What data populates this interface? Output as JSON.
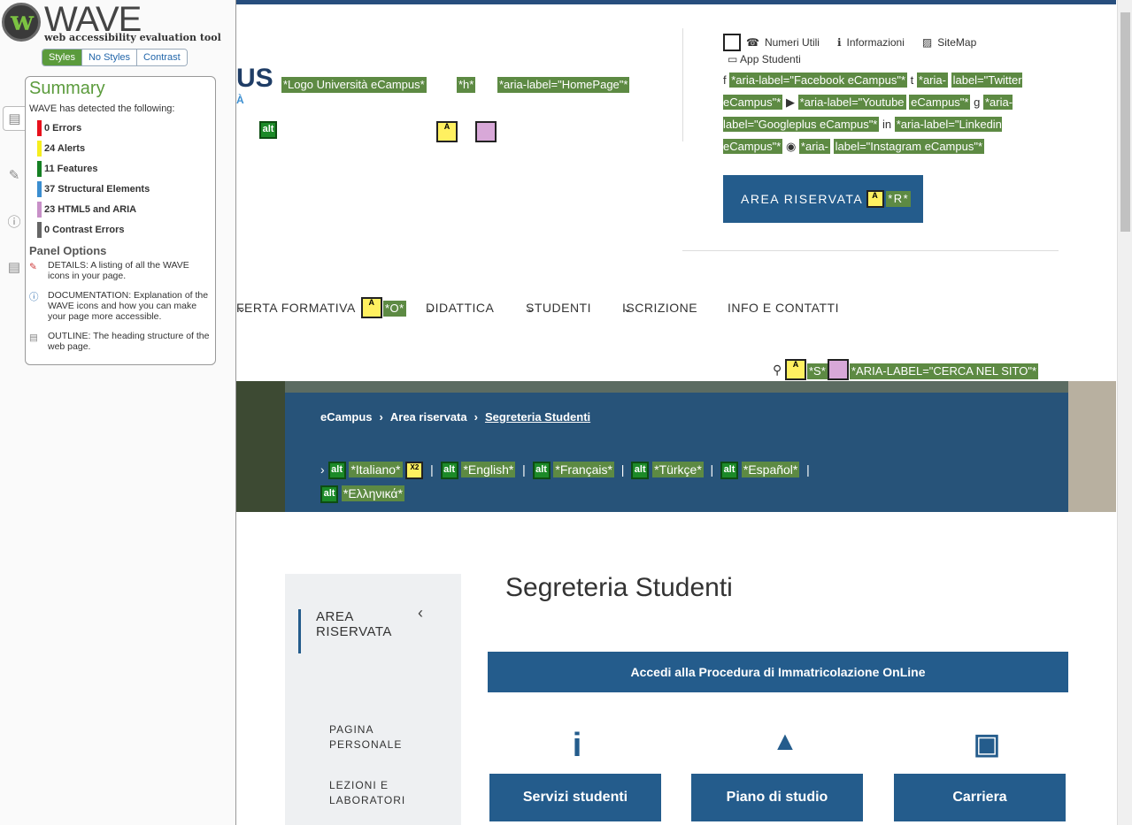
{
  "wave": {
    "title": "WAVE",
    "subtitle": "web accessibility evaluation tool",
    "tabs": [
      "Styles",
      "No Styles",
      "Contrast"
    ],
    "summary_title": "Summary",
    "intro": "WAVE has detected the following:",
    "stats": [
      {
        "label": "0 Errors",
        "color": "#e8101c"
      },
      {
        "label": "24 Alerts",
        "color": "#f6ee1e"
      },
      {
        "label": "11 Features",
        "color": "#158023"
      },
      {
        "label": "37 Structural Elements",
        "color": "#3b8ed0"
      },
      {
        "label": "23 HTML5 and ARIA",
        "color": "#c890c8"
      },
      {
        "label": "0 Contrast Errors",
        "color": "#666666"
      }
    ],
    "panel_options": "Panel Options",
    "options": [
      {
        "icon": "details-icon",
        "text": "DETAILS: A listing of all the WAVE icons in your page."
      },
      {
        "icon": "documentation-icon",
        "text": "DOCUMENTATION: Explanation of the WAVE icons and how you can make your page more accessible."
      },
      {
        "icon": "outline-icon",
        "text": "OUTLINE: The heading structure of the web page."
      }
    ]
  },
  "site": {
    "logo_fragment": "US",
    "logo_fragment_sub": "À",
    "labels": {
      "logo": "*Logo Università eCampus*",
      "h": "*h*",
      "homepage": "*aria-label=\"HomePage\"*",
      "o": "*O*",
      "s": "*S*",
      "cerca": "*ARIA-LABEL=\"CERCA NEL SITO\"*",
      "r": "*R*"
    },
    "util": {
      "numeri": "Numeri Utili",
      "informazioni": "Informazioni",
      "sitemap": "SiteMap",
      "app": "App Studenti"
    },
    "social": {
      "facebook": "*aria-label=\"Facebook eCampus\"*",
      "twitter_a": "*aria-",
      "twitter_b": "label=\"Twitter eCampus\"*",
      "youtube_a": "*aria-label=\"Youtube",
      "youtube_b": "eCampus\"*",
      "googleplus": "*aria-label=\"Googleplus eCampus\"*",
      "linkedin": "*aria-label=\"Linkedin eCampus\"*",
      "instagram_a": "*aria-",
      "instagram_b": "label=\"Instagram eCampus\"*"
    },
    "area_riservata": "AREA RISERVATA",
    "menu": [
      "FERTA FORMATIVA",
      "DIDATTICA",
      "STUDENTI",
      "ISCRIZIONE",
      "INFO E CONTATTI"
    ],
    "breadcrumb": [
      "eCampus",
      "Area riservata",
      "Segreteria Studenti"
    ],
    "languages": [
      "*Italiano*",
      "*English*",
      "*Français*",
      "*Türkçe*",
      "*Español*",
      "*Ελληνικά*"
    ],
    "x2": "X2",
    "sidebar_title": "AREA RISERVATA",
    "sidebar_items": [
      "PAGINA PERSONALE",
      "LEZIONI E LABORATORI"
    ],
    "page_title": "Segreteria Studenti",
    "cta": "Accedi alla Procedura di Immatricolazione OnLine",
    "tiles": [
      "Servizi studenti",
      "Piano di studio",
      "Carriera"
    ]
  }
}
